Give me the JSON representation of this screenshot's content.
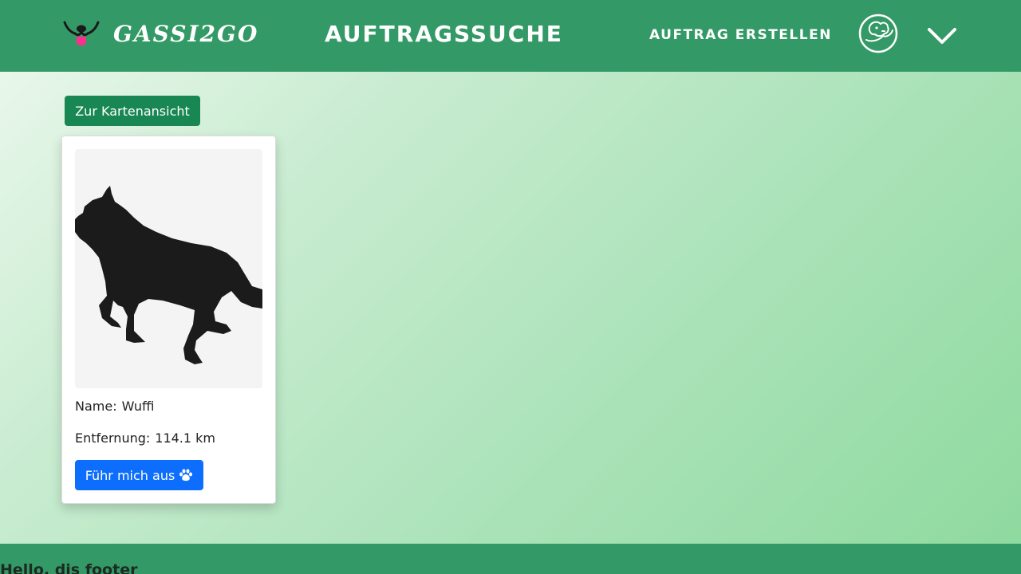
{
  "navbar": {
    "brand_name": "GASSI2GO",
    "logo_icon": "dog-face-logo-icon",
    "page_title": "AUFTRAGSSUCHE",
    "create_link": "AUFTRAG ERSTELLEN",
    "avatar_icon": "dog-avatar-icon",
    "menu_icon": "chevron-down-icon",
    "color": "#339966"
  },
  "actions": {
    "map_view_button": "Zur Kartenansicht",
    "map_view_button_color": "#198754"
  },
  "dog_card": {
    "image_icon": "dog-silhouette-image",
    "name_label": "Name:",
    "name_value": "Wuffi",
    "distance_label": "Entfernung:",
    "distance_value": "114.1 km",
    "walk_button": "Führ mich aus",
    "walk_button_icon": "paw-icon",
    "walk_button_color": "#0d6efd"
  },
  "footer": {
    "text": "Hello, dis footer"
  }
}
